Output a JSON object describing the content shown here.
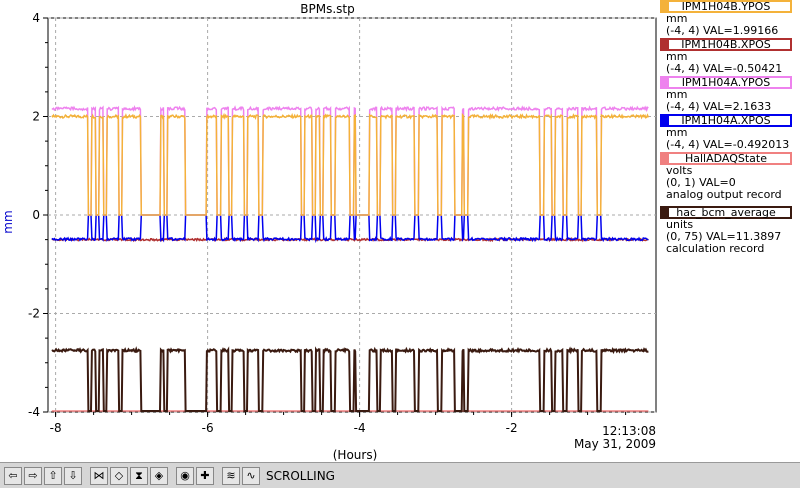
{
  "title": "BPMs.stp",
  "y_axis_label": "mm",
  "x_axis_label": "(Hours)",
  "time_stamp": "12:13:08",
  "date_stamp": "May 31, 2009",
  "legend": [
    {
      "name": "IPM1H04B.YPOS",
      "color": "#f4b23a",
      "units": "mm",
      "range_val": "(-4, 4) VAL=1.99166",
      "extra": ""
    },
    {
      "name": "IPM1H04B.XPOS",
      "color": "#b03030",
      "units": "mm",
      "range_val": "(-4, 4) VAL=-0.50421",
      "extra": ""
    },
    {
      "name": "IPM1H04A.YPOS",
      "color": "#ee82ee",
      "units": "mm",
      "range_val": "(-4, 4) VAL=2.1633",
      "extra": ""
    },
    {
      "name": "IPM1H04A.XPOS",
      "color": "#0000ee",
      "units": "mm",
      "range_val": "(-4, 4) VAL=-0.492013",
      "extra": ""
    },
    {
      "name": "HallADAQState",
      "color": "#f08080",
      "units": "volts",
      "range_val": "(0, 1) VAL=0",
      "extra": "analog output record"
    },
    {
      "name": "hac_bcm_average",
      "color": "#3a1a10",
      "units": "units",
      "range_val": "(0, 75) VAL=11.3897",
      "extra": "calculation record"
    }
  ],
  "chart_data": {
    "type": "line",
    "y_ticks": [
      "4",
      "2",
      "0",
      "-2",
      "-4"
    ],
    "x_ticks": [
      "-8",
      "-6",
      "-4",
      "-2"
    ],
    "ylim": [
      -4,
      4
    ],
    "xlim": [
      -8.1,
      -0.1
    ],
    "grid": true,
    "series": [
      {
        "name": "IPM1H04A.YPOS",
        "baseline": 2.16
      },
      {
        "name": "IPM1H04B.YPOS",
        "baseline": 2.0
      },
      {
        "name": "IPM1H04A.XPOS",
        "baseline": -0.49
      },
      {
        "name": "IPM1H04B.XPOS",
        "baseline": -0.5
      },
      {
        "name": "hac_bcm_average",
        "baseline": -2.75
      },
      {
        "name": "HallADAQState",
        "baseline": -3.98
      }
    ],
    "beam_trips_hours": [
      -7.55,
      -7.45,
      -7.35,
      -7.15,
      -6.85,
      -6.55,
      -6.25,
      -5.85,
      -5.7,
      -5.5,
      -5.3,
      -4.75,
      -4.6,
      -4.5,
      -4.35,
      -4.1,
      -3.9,
      -3.75,
      -3.55,
      -3.25,
      -2.95,
      -2.6,
      -1.6,
      -1.45,
      -1.3,
      -1.1,
      -0.85
    ],
    "beam_off_intervals_hours": [
      [
        -6.85,
        -6.62
      ],
      [
        -6.3,
        -6.02
      ],
      [
        -4.05,
        -3.9
      ],
      [
        -2.75,
        -2.65
      ]
    ]
  },
  "toolbar": {
    "buttons": [
      {
        "name": "scroll-left-button",
        "glyph": "⇦"
      },
      {
        "name": "scroll-right-button",
        "glyph": "⇨"
      },
      {
        "name": "scroll-up-button",
        "glyph": "⇧"
      },
      {
        "name": "scroll-down-button",
        "glyph": "⇩"
      },
      {
        "name": "zoom-in-x-button",
        "glyph": "⋈"
      },
      {
        "name": "zoom-out-x-button",
        "glyph": "◇"
      },
      {
        "name": "zoom-in-y-button",
        "glyph": "⧗"
      },
      {
        "name": "zoom-out-y-button",
        "glyph": "◈"
      },
      {
        "name": "reset-button",
        "glyph": "◉"
      },
      {
        "name": "add-button",
        "glyph": "✚"
      },
      {
        "name": "autoscale-button",
        "glyph": "≋"
      },
      {
        "name": "sparkline-button",
        "glyph": "∿"
      }
    ],
    "mode_label": "SCROLLING"
  }
}
